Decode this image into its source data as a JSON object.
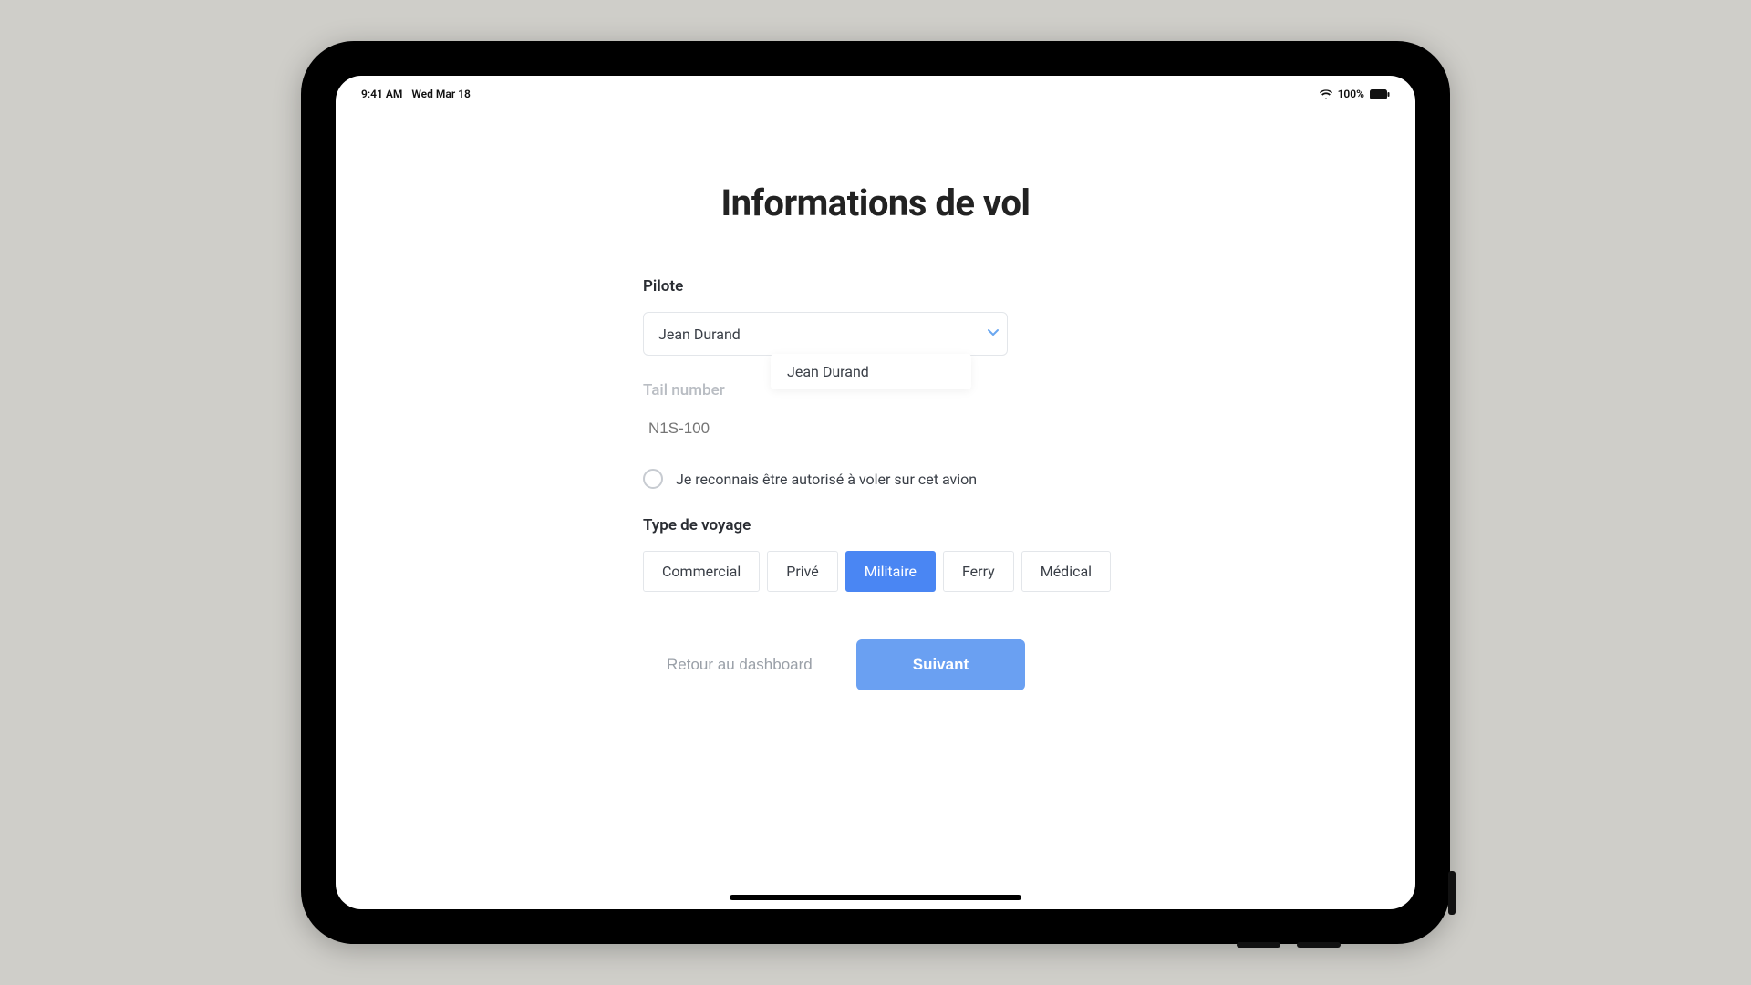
{
  "statusBar": {
    "time": "9:41 AM",
    "date": "Wed Mar 18",
    "battery": "100%"
  },
  "page": {
    "title": "Informations de vol"
  },
  "form": {
    "pilot": {
      "label": "Pilote",
      "selected": "Jean Durand",
      "option": "Jean Durand"
    },
    "tail": {
      "label": "Tail number",
      "placeholder": "N1S-100"
    },
    "auth": {
      "label": "Je reconnais être autorisé à voler sur cet avion",
      "checked": false
    },
    "tripType": {
      "label": "Type de voyage",
      "options": [
        "Commercial",
        "Privé",
        "Militaire",
        "Ferry",
        "Médical"
      ],
      "selectedIndex": 2
    }
  },
  "actions": {
    "back": "Retour au dashboard",
    "next": "Suivant"
  },
  "colors": {
    "primary": "#4a86f3",
    "primaryLight": "#6aa0f2"
  }
}
